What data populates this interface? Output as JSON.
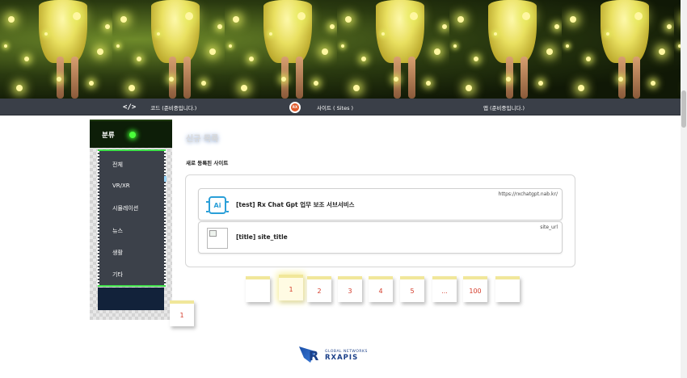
{
  "nav": {
    "code_label": "코드 (준비중입니다.)",
    "sites_label": "사이트 ( Sites )",
    "app_label": "앱 (준비중입니다.)",
    "code_icon": "</>",
    "rx_icon_text": "RX"
  },
  "sidebar": {
    "title": "분류",
    "items": [
      {
        "label": "전체"
      },
      {
        "label": "VR/XR"
      },
      {
        "label": "시뮬레이션"
      },
      {
        "label": "뉴스"
      },
      {
        "label": "생활"
      },
      {
        "label": "기타"
      }
    ],
    "status_color": "#4aff3a"
  },
  "main": {
    "title": "신규 목록",
    "subtitle": "새로 등록된 사이트",
    "sites": [
      {
        "title": "[test] Rx Chat Gpt 업무 보조 서브서비스",
        "url": "https://rxchatgpt.nab.kr/",
        "thumb": "ai-icon"
      },
      {
        "title": "[title] site_title",
        "url": "site_url",
        "thumb": "broken-image"
      }
    ]
  },
  "pagination": {
    "current": "1",
    "pages": [
      "",
      "1",
      "2",
      "3",
      "4",
      "5",
      "...",
      "100",
      ""
    ],
    "floating_page": "1"
  },
  "footer": {
    "logo_line1": "GLOBAL NETWORKS",
    "logo_line2": "RXAPIS",
    "logo_letter": "R"
  },
  "colors": {
    "navbar": "#3a3f48",
    "sidebar_dark": "#0d1e08",
    "sidebar_list": "#3c414a",
    "accent_green": "#3ee04a",
    "page_number": "#d43b2a",
    "logo_blue": "#1a3f88"
  }
}
